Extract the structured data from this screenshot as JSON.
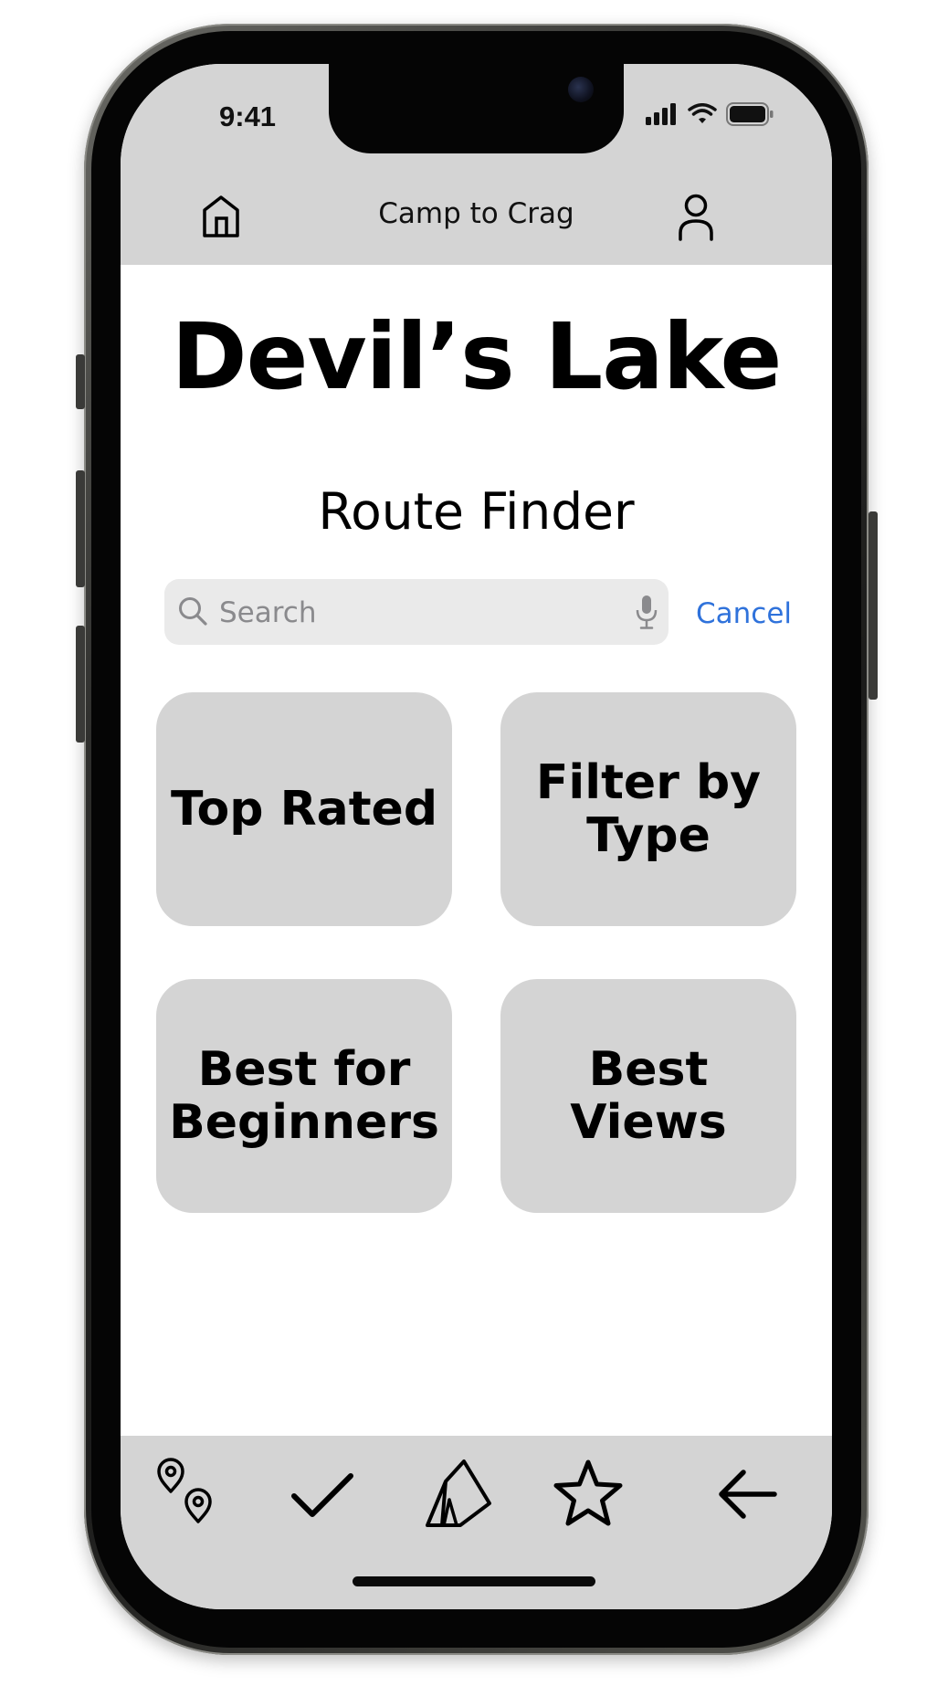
{
  "status_bar": {
    "time": "9:41"
  },
  "header": {
    "title": "Camp to Crag",
    "home_icon": "home-icon",
    "profile_icon": "user-icon"
  },
  "page": {
    "title": "Devil’s Lake",
    "section_title": "Route Finder"
  },
  "search": {
    "placeholder": "Search",
    "value": "",
    "cancel_label": "Cancel"
  },
  "tiles": [
    {
      "label": "Top Rated"
    },
    {
      "label": "Filter by Type"
    },
    {
      "label": "Best for Beginners"
    },
    {
      "label": "Best Views"
    }
  ],
  "tab_bar": {
    "items": [
      {
        "icon": "map-pins-icon"
      },
      {
        "icon": "checkmark-icon"
      },
      {
        "icon": "tent-icon"
      },
      {
        "icon": "star-icon"
      },
      {
        "icon": "back-arrow-icon"
      }
    ]
  },
  "colors": {
    "bar_background": "#d4d4d4",
    "tile_background": "#d4d4d4",
    "search_background": "#eaeaea",
    "accent": "#2f72db"
  }
}
